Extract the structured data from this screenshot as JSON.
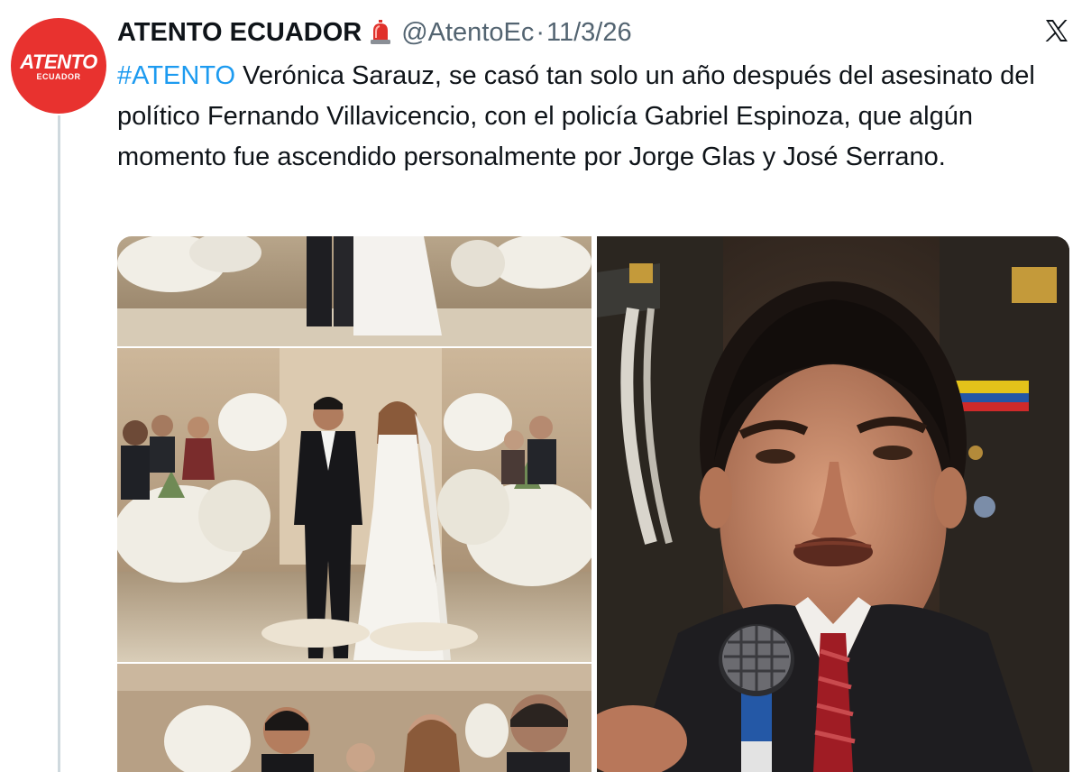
{
  "author": {
    "display_name": "ATENTO ECUADOR",
    "handle": "@AtentoEc",
    "separator": "·",
    "timestamp": "11/3/26",
    "avatar_brand": "ATENTO",
    "avatar_sub": "ECUADOR",
    "avatar_color": "#e8322f"
  },
  "badge_icon": "siren-emoji",
  "platform_icon": "x-logo-icon",
  "tweet": {
    "hashtag": "#ATENTO",
    "body": " Verónica Sarauz, se casó tan solo un año después del asesinato del político Fernando Villavicencio, con el policía Gabriel Espinoza, que algún momento fue ascendido personalmente por Jorge Glas y José Serrano."
  },
  "media": [
    {
      "name": "wedding-photo-collage",
      "description_icon": "photo"
    },
    {
      "name": "speaker-microphone-photo",
      "description_icon": "photo"
    }
  ],
  "colors": {
    "text": "#0f1419",
    "secondary": "#536471",
    "link": "#1d9bf0",
    "thread_line": "#cfd9de"
  }
}
